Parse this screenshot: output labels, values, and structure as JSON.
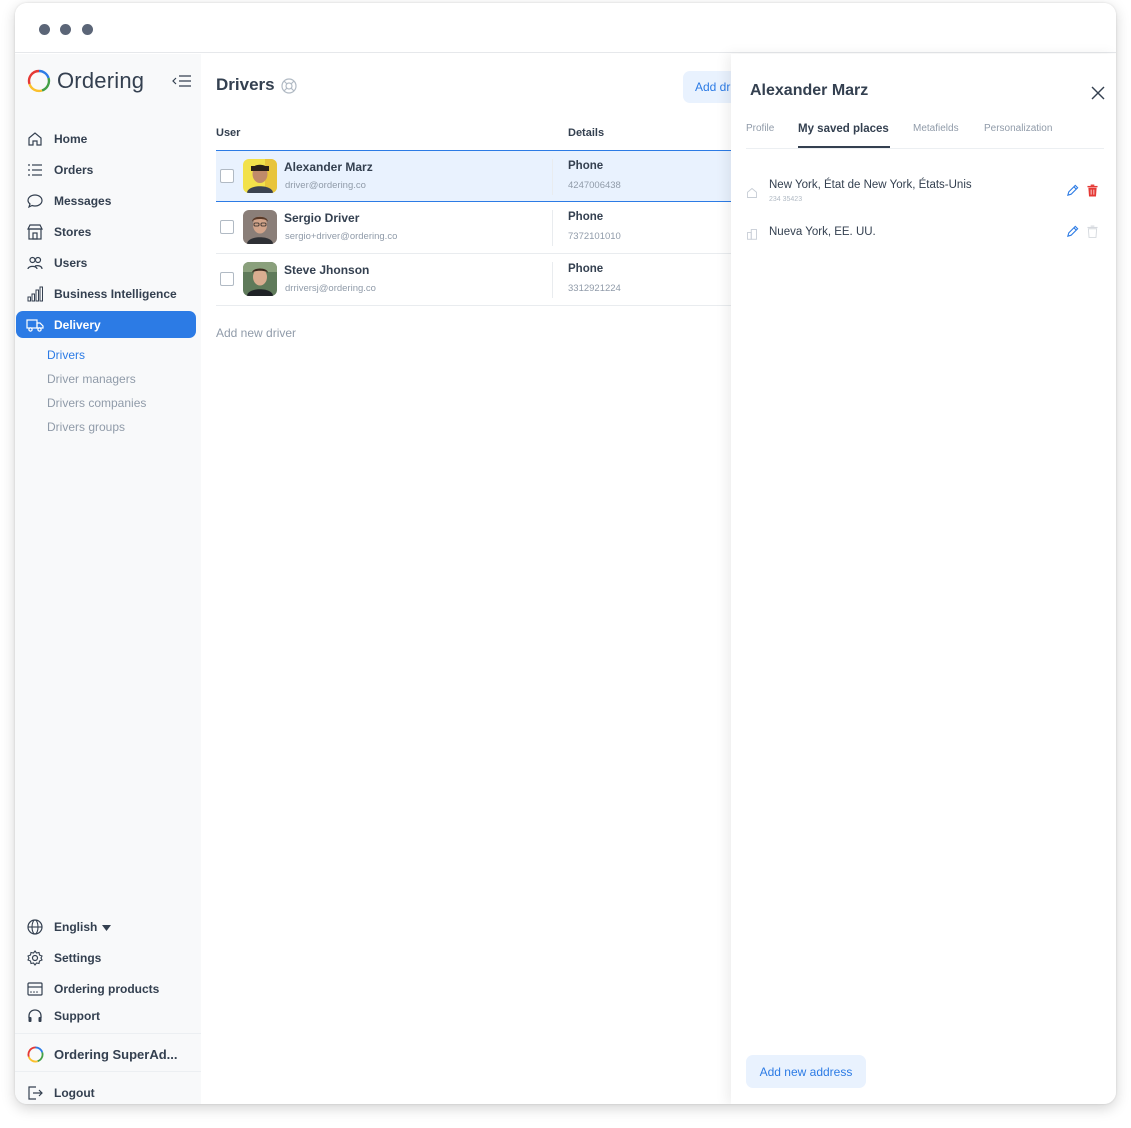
{
  "app": {
    "logo_text": "Ordering",
    "brand_colors": [
      "#e53935",
      "#fbc02d",
      "#43a047",
      "#2c7be5"
    ]
  },
  "sidebar": {
    "items": [
      {
        "label": "Home",
        "icon": "home-icon"
      },
      {
        "label": "Orders",
        "icon": "list-icon"
      },
      {
        "label": "Messages",
        "icon": "chat-icon"
      },
      {
        "label": "Stores",
        "icon": "store-icon"
      },
      {
        "label": "Users",
        "icon": "users-icon"
      },
      {
        "label": "Business Intelligence",
        "icon": "chart-icon"
      },
      {
        "label": "Delivery",
        "icon": "truck-icon",
        "active": true
      }
    ],
    "delivery_sub": [
      "Drivers",
      "Driver managers",
      "Drivers companies",
      "Drivers groups"
    ],
    "bottom": {
      "language": "English",
      "settings": "Settings",
      "products": "Ordering products",
      "support": "Support",
      "account": "Ordering SuperAd...",
      "logout": "Logout"
    }
  },
  "main": {
    "title": "Drivers",
    "add_button": "Add driver",
    "columns": {
      "user": "User",
      "details": "Details"
    },
    "drivers": [
      {
        "name": "Alexander Marz",
        "email": "driver@ordering.co",
        "detail_label": "Phone",
        "phone": "4247006438",
        "selected": true
      },
      {
        "name": "Sergio Driver",
        "email": "sergio+driver@ordering.co",
        "detail_label": "Phone",
        "phone": "7372101010"
      },
      {
        "name": "Steve Jhonson",
        "email": "drriversj@ordering.co",
        "detail_label": "Phone",
        "phone": "3312921224"
      }
    ],
    "add_new": "Add new driver"
  },
  "panel": {
    "title": "Alexander Marz",
    "tabs": [
      "Profile",
      "My saved places",
      "Metafields",
      "Personalization"
    ],
    "active_tab": "My saved places",
    "addresses": [
      {
        "address": "New York, État de New York, États-Unis",
        "sub": "234 35423",
        "icon": "home-icon"
      },
      {
        "address": "Nueva York, EE. UU.",
        "sub": "",
        "icon": "building-icon"
      }
    ],
    "add_address": "Add new address"
  },
  "colors": {
    "accent": "#2c7be5",
    "danger": "#e53935",
    "text": "#344050",
    "muted": "#909ba9"
  }
}
